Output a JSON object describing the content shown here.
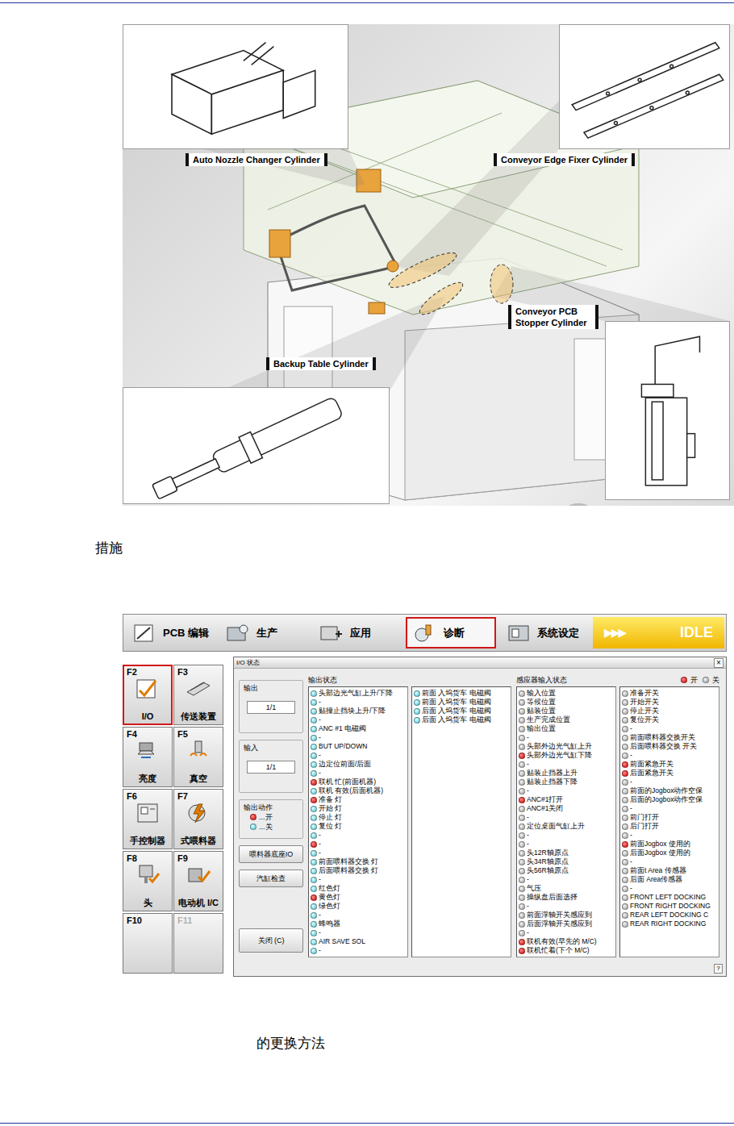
{
  "page": {
    "heading": "措施",
    "caption": "的更换方法"
  },
  "illustration": {
    "callouts": [
      {
        "label": "Auto Nozzle Changer Cylinder"
      },
      {
        "label": "Conveyor Edge Fixer Cylinder"
      },
      {
        "label": "Conveyor PCB Stopper Cylinder"
      },
      {
        "label": "Backup Table Cylinder"
      }
    ]
  },
  "app": {
    "toolbar": [
      {
        "label": "PCB 编辑",
        "selected": false
      },
      {
        "label": "生产",
        "selected": false
      },
      {
        "label": "应用",
        "selected": false
      },
      {
        "label": "诊断",
        "selected": true
      },
      {
        "label": "系统设定",
        "selected": false
      }
    ],
    "status": {
      "arrows": "▶▶▶",
      "text": "IDLE"
    },
    "fkeys": [
      {
        "key": "F2",
        "label": "I/O",
        "selected": true,
        "disabled": false
      },
      {
        "key": "F3",
        "label": "传送装置",
        "selected": false,
        "disabled": false
      },
      {
        "key": "F4",
        "label": "亮度",
        "selected": false,
        "disabled": false
      },
      {
        "key": "F5",
        "label": "真空",
        "selected": false,
        "disabled": false
      },
      {
        "key": "F6",
        "label": "手控制器",
        "selected": false,
        "disabled": false
      },
      {
        "key": "F7",
        "label": "式喂料器",
        "selected": false,
        "disabled": false
      },
      {
        "key": "F8",
        "label": "头",
        "selected": false,
        "disabled": false
      },
      {
        "key": "F9",
        "label": "电动机 I/C",
        "selected": false,
        "disabled": false
      },
      {
        "key": "F10",
        "label": "",
        "selected": false,
        "disabled": false
      },
      {
        "key": "F11",
        "label": "",
        "selected": false,
        "disabled": true
      }
    ],
    "window": {
      "title": "I/O 状态",
      "close": "×",
      "help": "?",
      "pagers": [
        {
          "title": "输出",
          "value": "1/1"
        },
        {
          "title": "输入",
          "value": "1/1"
        }
      ],
      "action_legend": {
        "title": "输出动作",
        "items": [
          {
            "label": "...开",
            "on": true
          },
          {
            "label": "...关",
            "on": false
          }
        ]
      },
      "buttons": [
        "喂料器底座IO",
        "汽缸检查",
        "关闭 (C)"
      ],
      "legend": [
        {
          "label": "开",
          "on": true
        },
        {
          "label": "关",
          "on": false
        }
      ],
      "outputs": {
        "title": "输出状态",
        "columns": [
          [
            {
              "label": "头部边光气缸上升/下降",
              "on": false
            },
            {
              "label": "-",
              "on": false
            },
            {
              "label": "贴撞止挡块上升/下降",
              "on": false
            },
            {
              "label": "-",
              "on": false
            },
            {
              "label": "ANC #1 电磁阀",
              "on": false
            },
            {
              "label": "-",
              "on": false
            },
            {
              "label": "BUT UP/DOWN",
              "on": false
            },
            {
              "label": "-",
              "on": false
            },
            {
              "label": "边定位前面/后面",
              "on": false
            },
            {
              "label": "-",
              "on": false
            },
            {
              "label": "联机 忙(前面机器)",
              "on": true
            },
            {
              "label": "联机 有效(后面机器)",
              "on": false
            },
            {
              "label": "准备 灯",
              "on": true
            },
            {
              "label": "开始 灯",
              "on": false
            },
            {
              "label": "停止 灯",
              "on": false
            },
            {
              "label": "复位 灯",
              "on": false
            },
            {
              "label": "-",
              "on": false
            },
            {
              "label": "-",
              "on": true
            },
            {
              "label": "-",
              "on": false
            },
            {
              "label": "前面喂料器交换 灯",
              "on": false
            },
            {
              "label": "后面喂料器交换 灯",
              "on": false
            },
            {
              "label": "-",
              "on": false
            },
            {
              "label": "红色灯",
              "on": false
            },
            {
              "label": "黄色灯",
              "on": true
            },
            {
              "label": "绿色灯",
              "on": false
            },
            {
              "label": "-",
              "on": false
            },
            {
              "label": "蜂鸣器",
              "on": false
            },
            {
              "label": "-",
              "on": false
            },
            {
              "label": "AIR SAVE SOL",
              "on": false
            },
            {
              "label": "-",
              "on": false
            }
          ],
          [
            {
              "label": "前面 入坞货车 电磁阀",
              "on": false
            },
            {
              "label": "前面 入坞货车 电磁阀",
              "on": false
            },
            {
              "label": "后面 入坞货车 电磁阀",
              "on": false
            },
            {
              "label": "后面 入坞货车 电磁阀",
              "on": false
            }
          ]
        ]
      },
      "sensors": {
        "title": "感应器输入状态",
        "columns": [
          [
            {
              "label": "输入位置",
              "on": false
            },
            {
              "label": "等候位置",
              "on": false
            },
            {
              "label": "贴装位置",
              "on": false
            },
            {
              "label": "生产完成位置",
              "on": false
            },
            {
              "label": "输出位置",
              "on": false
            },
            {
              "label": "-",
              "on": false
            },
            {
              "label": "头部外边光气缸上升",
              "on": false
            },
            {
              "label": "头部外边光气缸下降",
              "on": true
            },
            {
              "label": "-",
              "on": false
            },
            {
              "label": "贴装止挡器上升",
              "on": false
            },
            {
              "label": "贴装止挡器下降",
              "on": false
            },
            {
              "label": "-",
              "on": false
            },
            {
              "label": "ANC#1打开",
              "on": true
            },
            {
              "label": "ANC#1关闭",
              "on": false
            },
            {
              "label": "-",
              "on": false
            },
            {
              "label": "定位桌面气缸上升",
              "on": false
            },
            {
              "label": "-",
              "on": false
            },
            {
              "label": "-",
              "on": false
            },
            {
              "label": "头12R轴原点",
              "on": false
            },
            {
              "label": "头34R轴原点",
              "on": false
            },
            {
              "label": "头56R轴原点",
              "on": false
            },
            {
              "label": "-",
              "on": false
            },
            {
              "label": "气压",
              "on": false
            },
            {
              "label": "操纵盘后面选择",
              "on": false
            },
            {
              "label": "-",
              "on": false
            },
            {
              "label": "前面浮轴开关感应到",
              "on": false
            },
            {
              "label": "后面浮轴开关感应到",
              "on": false
            },
            {
              "label": "-",
              "on": false
            },
            {
              "label": "联机有效(早先的 M/C)",
              "on": true
            },
            {
              "label": "联机忙着(下个 M/C)",
              "on": true
            }
          ],
          [
            {
              "label": "准备开关",
              "on": false
            },
            {
              "label": "开始开关",
              "on": false
            },
            {
              "label": "停止开关",
              "on": false
            },
            {
              "label": "复位开关",
              "on": false
            },
            {
              "label": "-",
              "on": false
            },
            {
              "label": "前面喂料器交换开关",
              "on": false
            },
            {
              "label": "后面喂料器交换 开关",
              "on": false
            },
            {
              "label": "-",
              "on": false
            },
            {
              "label": "前面紧急开关",
              "on": true
            },
            {
              "label": "后面紧急开关",
              "on": true
            },
            {
              "label": "-",
              "on": false
            },
            {
              "label": "前面的Jogbox动作空保",
              "on": false
            },
            {
              "label": "后面的Jogbox动作空保",
              "on": false
            },
            {
              "label": "-",
              "on": false
            },
            {
              "label": "前门打开",
              "on": false
            },
            {
              "label": "后门打开",
              "on": false
            },
            {
              "label": "-",
              "on": false
            },
            {
              "label": "前面Jogbox 使用的",
              "on": true
            },
            {
              "label": "后面Jogbox 使用的",
              "on": false
            },
            {
              "label": "-",
              "on": false
            },
            {
              "label": "前面t Area 传感器",
              "on": false
            },
            {
              "label": "后面 Area传感器",
              "on": false
            },
            {
              "label": "-",
              "on": false
            },
            {
              "label": "FRONT LEFT DOCKING",
              "on": false
            },
            {
              "label": "FRONT RIGHT DOCKING",
              "on": false
            },
            {
              "label": "REAR LEFT DOCKING C",
              "on": false
            },
            {
              "label": "REAR RIGHT DOCKING",
              "on": false
            }
          ]
        ]
      }
    }
  }
}
